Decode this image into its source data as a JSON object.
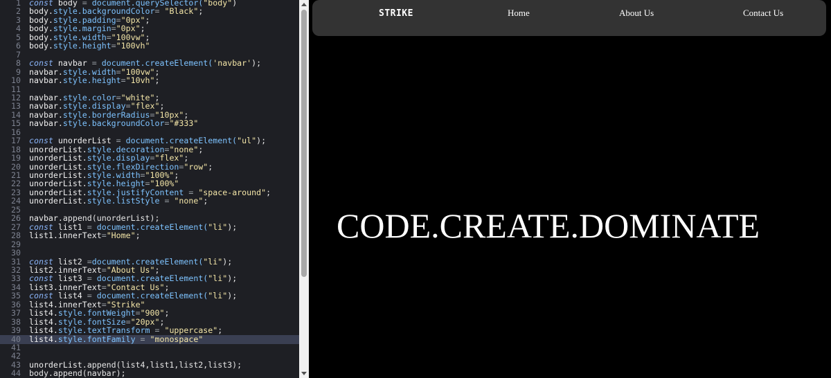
{
  "editor": {
    "active_line": 40,
    "lines": [
      {
        "n": "1",
        "tokens": [
          {
            "t": "const ",
            "c": "kw"
          },
          {
            "t": "body ",
            "c": "var"
          },
          {
            "t": "= ",
            "c": "op"
          },
          {
            "t": "document.querySelector(",
            "c": "prop"
          },
          {
            "t": "\"body\"",
            "c": "str"
          },
          {
            "t": ")",
            "c": "p"
          }
        ]
      },
      {
        "n": "2",
        "tokens": [
          {
            "t": "body.",
            "c": "var"
          },
          {
            "t": "style.backgroundColor",
            "c": "prop"
          },
          {
            "t": "= ",
            "c": "op"
          },
          {
            "t": "\"Black\"",
            "c": "str"
          },
          {
            "t": ";",
            "c": "p"
          }
        ]
      },
      {
        "n": "3",
        "tokens": [
          {
            "t": "body.",
            "c": "var"
          },
          {
            "t": "style.padding",
            "c": "prop"
          },
          {
            "t": "=",
            "c": "op"
          },
          {
            "t": "\"0px\"",
            "c": "str"
          },
          {
            "t": ";",
            "c": "p"
          }
        ]
      },
      {
        "n": "4",
        "tokens": [
          {
            "t": "body.",
            "c": "var"
          },
          {
            "t": "style.margin",
            "c": "prop"
          },
          {
            "t": "=",
            "c": "op"
          },
          {
            "t": "\"0px\"",
            "c": "str"
          },
          {
            "t": ";",
            "c": "p"
          }
        ]
      },
      {
        "n": "5",
        "tokens": [
          {
            "t": "body.",
            "c": "var"
          },
          {
            "t": "style.width",
            "c": "prop"
          },
          {
            "t": "=",
            "c": "op"
          },
          {
            "t": "\"100vw\"",
            "c": "str"
          },
          {
            "t": ";",
            "c": "p"
          }
        ]
      },
      {
        "n": "6",
        "tokens": [
          {
            "t": "body.",
            "c": "var"
          },
          {
            "t": "style.height",
            "c": "prop"
          },
          {
            "t": "=",
            "c": "op"
          },
          {
            "t": "\"100vh\"",
            "c": "str"
          }
        ]
      },
      {
        "n": "7",
        "tokens": []
      },
      {
        "n": "8",
        "tokens": [
          {
            "t": "const ",
            "c": "kw"
          },
          {
            "t": "navbar ",
            "c": "var"
          },
          {
            "t": "= ",
            "c": "op"
          },
          {
            "t": "document.createElement(",
            "c": "prop"
          },
          {
            "t": "'navbar'",
            "c": "str"
          },
          {
            "t": ");",
            "c": "p"
          }
        ]
      },
      {
        "n": "9",
        "tokens": [
          {
            "t": "navbar.",
            "c": "var"
          },
          {
            "t": "style.width",
            "c": "prop"
          },
          {
            "t": "=",
            "c": "op"
          },
          {
            "t": "\"100vw\"",
            "c": "str"
          },
          {
            "t": ";",
            "c": "p"
          }
        ]
      },
      {
        "n": "10",
        "tokens": [
          {
            "t": "navbar.",
            "c": "var"
          },
          {
            "t": "style.height",
            "c": "prop"
          },
          {
            "t": "=",
            "c": "op"
          },
          {
            "t": "\"10vh\"",
            "c": "str"
          },
          {
            "t": ";",
            "c": "p"
          }
        ]
      },
      {
        "n": "11",
        "tokens": []
      },
      {
        "n": "12",
        "tokens": [
          {
            "t": "navbar.",
            "c": "var"
          },
          {
            "t": "style.color",
            "c": "prop"
          },
          {
            "t": "=",
            "c": "op"
          },
          {
            "t": "\"white\"",
            "c": "str"
          },
          {
            "t": ";",
            "c": "p"
          }
        ]
      },
      {
        "n": "13",
        "tokens": [
          {
            "t": "navbar.",
            "c": "var"
          },
          {
            "t": "style.display",
            "c": "prop"
          },
          {
            "t": "=",
            "c": "op"
          },
          {
            "t": "\"flex\"",
            "c": "str"
          },
          {
            "t": ";",
            "c": "p"
          }
        ]
      },
      {
        "n": "14",
        "tokens": [
          {
            "t": "navbar.",
            "c": "var"
          },
          {
            "t": "style.borderRadius",
            "c": "prop"
          },
          {
            "t": "=",
            "c": "op"
          },
          {
            "t": "\"10px\"",
            "c": "str"
          },
          {
            "t": ";",
            "c": "p"
          }
        ]
      },
      {
        "n": "15",
        "tokens": [
          {
            "t": "navbar.",
            "c": "var"
          },
          {
            "t": "style.backgroundColor",
            "c": "prop"
          },
          {
            "t": "=",
            "c": "op"
          },
          {
            "t": "\"#333\"",
            "c": "str"
          }
        ]
      },
      {
        "n": "16",
        "tokens": []
      },
      {
        "n": "17",
        "tokens": [
          {
            "t": "const ",
            "c": "kw"
          },
          {
            "t": "unorderList ",
            "c": "var"
          },
          {
            "t": "= ",
            "c": "op"
          },
          {
            "t": "document.createElement(",
            "c": "prop"
          },
          {
            "t": "\"ul\"",
            "c": "str"
          },
          {
            "t": ");",
            "c": "p"
          }
        ]
      },
      {
        "n": "18",
        "tokens": [
          {
            "t": "unorderList.",
            "c": "var"
          },
          {
            "t": "style.decoration",
            "c": "prop"
          },
          {
            "t": "=",
            "c": "op"
          },
          {
            "t": "\"none\"",
            "c": "str"
          },
          {
            "t": ";",
            "c": "p"
          }
        ]
      },
      {
        "n": "19",
        "tokens": [
          {
            "t": "unorderList.",
            "c": "var"
          },
          {
            "t": "style.display",
            "c": "prop"
          },
          {
            "t": "=",
            "c": "op"
          },
          {
            "t": "\"flex\"",
            "c": "str"
          },
          {
            "t": ";",
            "c": "p"
          }
        ]
      },
      {
        "n": "20",
        "tokens": [
          {
            "t": "unorderList.",
            "c": "var"
          },
          {
            "t": "style.flexDirection",
            "c": "prop"
          },
          {
            "t": "=",
            "c": "op"
          },
          {
            "t": "\"row\"",
            "c": "str"
          },
          {
            "t": ";",
            "c": "p"
          }
        ]
      },
      {
        "n": "21",
        "tokens": [
          {
            "t": "unorderList.",
            "c": "var"
          },
          {
            "t": "style.width",
            "c": "prop"
          },
          {
            "t": "=",
            "c": "op"
          },
          {
            "t": "\"100%\"",
            "c": "str"
          },
          {
            "t": ";",
            "c": "p"
          }
        ]
      },
      {
        "n": "22",
        "tokens": [
          {
            "t": "unorderList.",
            "c": "var"
          },
          {
            "t": "style.height",
            "c": "prop"
          },
          {
            "t": "=",
            "c": "op"
          },
          {
            "t": "\"100%\"",
            "c": "str"
          }
        ]
      },
      {
        "n": "23",
        "tokens": [
          {
            "t": "unorderList.",
            "c": "var"
          },
          {
            "t": "style.justifyContent",
            "c": "prop"
          },
          {
            "t": " = ",
            "c": "op"
          },
          {
            "t": "\"space-around\"",
            "c": "str"
          },
          {
            "t": ";",
            "c": "p"
          }
        ]
      },
      {
        "n": "24",
        "tokens": [
          {
            "t": "unorderList.",
            "c": "var"
          },
          {
            "t": "style.listStyle",
            "c": "prop"
          },
          {
            "t": " = ",
            "c": "op"
          },
          {
            "t": "\"none\"",
            "c": "str"
          },
          {
            "t": ";",
            "c": "p"
          }
        ]
      },
      {
        "n": "25",
        "tokens": []
      },
      {
        "n": "26",
        "tokens": [
          {
            "t": "navbar.",
            "c": "var"
          },
          {
            "t": "append(unorderList);",
            "c": "p"
          }
        ]
      },
      {
        "n": "27",
        "tokens": [
          {
            "t": "const ",
            "c": "kw"
          },
          {
            "t": "list1 ",
            "c": "var"
          },
          {
            "t": "= ",
            "c": "op"
          },
          {
            "t": "document.createElement(",
            "c": "prop"
          },
          {
            "t": "\"li\"",
            "c": "str"
          },
          {
            "t": ");",
            "c": "p"
          }
        ]
      },
      {
        "n": "28",
        "tokens": [
          {
            "t": "list1.innerText",
            "c": "var"
          },
          {
            "t": "=",
            "c": "op"
          },
          {
            "t": "\"Home\"",
            "c": "str"
          },
          {
            "t": ";",
            "c": "p"
          }
        ]
      },
      {
        "n": "29",
        "tokens": []
      },
      {
        "n": "30",
        "tokens": []
      },
      {
        "n": "31",
        "tokens": [
          {
            "t": "const ",
            "c": "kw"
          },
          {
            "t": "list2 ",
            "c": "var"
          },
          {
            "t": "=",
            "c": "op"
          },
          {
            "t": "document.createElement(",
            "c": "prop"
          },
          {
            "t": "\"li\"",
            "c": "str"
          },
          {
            "t": ");",
            "c": "p"
          }
        ]
      },
      {
        "n": "32",
        "tokens": [
          {
            "t": "list2.innerText",
            "c": "var"
          },
          {
            "t": "=",
            "c": "op"
          },
          {
            "t": "\"About Us\"",
            "c": "str"
          },
          {
            "t": ";",
            "c": "p"
          }
        ]
      },
      {
        "n": "33",
        "tokens": [
          {
            "t": "const ",
            "c": "kw"
          },
          {
            "t": "list3 ",
            "c": "var"
          },
          {
            "t": "= ",
            "c": "op"
          },
          {
            "t": "document.createElement(",
            "c": "prop"
          },
          {
            "t": "\"li\"",
            "c": "str"
          },
          {
            "t": ");",
            "c": "p"
          }
        ]
      },
      {
        "n": "34",
        "tokens": [
          {
            "t": "list3.innerText",
            "c": "var"
          },
          {
            "t": "=",
            "c": "op"
          },
          {
            "t": "\"Contact Us\"",
            "c": "str"
          },
          {
            "t": ";",
            "c": "p"
          }
        ]
      },
      {
        "n": "35",
        "tokens": [
          {
            "t": "const ",
            "c": "kw"
          },
          {
            "t": "list4 ",
            "c": "var"
          },
          {
            "t": "= ",
            "c": "op"
          },
          {
            "t": "document.createElement(",
            "c": "prop"
          },
          {
            "t": "\"li\"",
            "c": "str"
          },
          {
            "t": ");",
            "c": "p"
          }
        ]
      },
      {
        "n": "36",
        "tokens": [
          {
            "t": "list4.innerText",
            "c": "var"
          },
          {
            "t": "=",
            "c": "op"
          },
          {
            "t": "\"Strike\"",
            "c": "str"
          }
        ]
      },
      {
        "n": "37",
        "tokens": [
          {
            "t": "list4.",
            "c": "var"
          },
          {
            "t": "style.fontWeight",
            "c": "prop"
          },
          {
            "t": "=",
            "c": "op"
          },
          {
            "t": "\"900\"",
            "c": "str"
          },
          {
            "t": ";",
            "c": "p"
          }
        ]
      },
      {
        "n": "38",
        "tokens": [
          {
            "t": "list4.",
            "c": "var"
          },
          {
            "t": "style.fontSize",
            "c": "prop"
          },
          {
            "t": "=",
            "c": "op"
          },
          {
            "t": "\"20px\"",
            "c": "str"
          },
          {
            "t": ";",
            "c": "p"
          }
        ]
      },
      {
        "n": "39",
        "tokens": [
          {
            "t": "list4.",
            "c": "var"
          },
          {
            "t": "style.textTransform",
            "c": "prop"
          },
          {
            "t": " = ",
            "c": "op"
          },
          {
            "t": "\"uppercase\"",
            "c": "str"
          },
          {
            "t": ";",
            "c": "p"
          }
        ]
      },
      {
        "n": "40",
        "tokens": [
          {
            "t": "list4.",
            "c": "var"
          },
          {
            "t": "style.fontFamily",
            "c": "prop"
          },
          {
            "t": " = ",
            "c": "op"
          },
          {
            "t": "\"monospace\"",
            "c": "str"
          }
        ]
      },
      {
        "n": "41",
        "tokens": []
      },
      {
        "n": "42",
        "tokens": []
      },
      {
        "n": "43",
        "tokens": [
          {
            "t": "unorderList.",
            "c": "var"
          },
          {
            "t": "append(list4,list1,list2,list3);",
            "c": "p"
          }
        ]
      },
      {
        "n": "44",
        "tokens": [
          {
            "t": "body.append(navbar);",
            "c": "p"
          }
        ]
      }
    ]
  },
  "preview": {
    "navbar": {
      "brand": "Strike",
      "items": [
        "Home",
        "About Us",
        "Contact Us"
      ]
    },
    "headline": "CODE.CREATE.DOMINATE"
  },
  "colors": {
    "editor_bg": "#1e1f24",
    "navbar_bg": "#333333",
    "page_bg": "#000000"
  }
}
